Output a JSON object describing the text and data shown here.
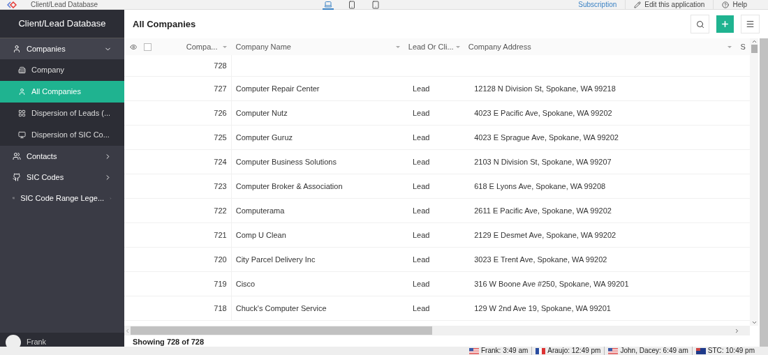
{
  "topbar": {
    "app_title": "Client/Lead Database",
    "devices": [
      {
        "kind": "desktop",
        "selected": true
      },
      {
        "kind": "phone",
        "selected": false
      },
      {
        "kind": "tablet",
        "selected": false
      }
    ],
    "links": [
      {
        "kind": "subscription",
        "label": "Subscription"
      },
      {
        "kind": "edit",
        "label": "Edit this application"
      },
      {
        "kind": "help",
        "label": "Help"
      }
    ]
  },
  "sidebar": {
    "title": "Client/Lead Database",
    "items": [
      {
        "label": "Companies",
        "expanded": true,
        "children": [
          {
            "label": "Company",
            "selected": false
          },
          {
            "label": "All Companies",
            "selected": true
          },
          {
            "label": "Dispersion of Leads (...",
            "selected": false
          },
          {
            "label": "Dispersion of SIC Co...",
            "selected": false
          }
        ]
      },
      {
        "label": "Contacts",
        "expanded": false
      },
      {
        "label": "SIC Codes",
        "expanded": false
      },
      {
        "label": "SIC Code Range Lege...",
        "expanded": false
      }
    ],
    "user": {
      "name": "Frank"
    }
  },
  "main": {
    "title": "All Companies",
    "table": {
      "select_all_checked": false,
      "columns": [
        {
          "label": "Compa..."
        },
        {
          "label": "Company Name"
        },
        {
          "label": "Lead Or Cli..."
        },
        {
          "label": "Company Address"
        },
        {
          "label": "S"
        }
      ],
      "rows": [
        {
          "number": "728"
        },
        {
          "number": "727",
          "name": "Computer Repair Center",
          "type": "Lead",
          "address": "12128 N Division St, Spokane, WA 99218"
        },
        {
          "number": "726",
          "name": "Computer Nutz",
          "type": "Lead",
          "address": "4023 E Pacific Ave, Spokane, WA 99202"
        },
        {
          "number": "725",
          "name": "Computer Guruz",
          "type": "Lead",
          "address": "4023 E Sprague Ave, Spokane, WA 99202"
        },
        {
          "number": "724",
          "name": "Computer Business Solutions",
          "type": "Lead",
          "address": "2103 N Division St, Spokane, WA 99207"
        },
        {
          "number": "723",
          "name": "Computer Broker & Association",
          "type": "Lead",
          "address": "618 E Lyons Ave, Spokane, WA 99208"
        },
        {
          "number": "722",
          "name": "Computerama",
          "type": "Lead",
          "address": "2611 E Pacific Ave, Spokane, WA 99202"
        },
        {
          "number": "721",
          "name": "Comp U Clean",
          "type": "Lead",
          "address": "2129 E Desmet Ave, Spokane, WA 99202"
        },
        {
          "number": "720",
          "name": "City Parcel Delivery Inc",
          "type": "Lead",
          "address": "3023 E Trent Ave, Spokane, WA 99202"
        },
        {
          "number": "719",
          "name": "Cisco",
          "type": "Lead",
          "address": "316 W Boone Ave #250, Spokane, WA 99201"
        },
        {
          "number": "718",
          "name": "Chuck's Computer Service",
          "type": "Lead",
          "address": "129 W 2nd Ave 19, Spokane, WA 99201"
        }
      ]
    },
    "footer": "Showing 728 of 728"
  },
  "taskbar": {
    "clocks": [
      {
        "label": "Frank: 3:49 am"
      },
      {
        "label": "Araujo: 12:49 pm"
      },
      {
        "label": "John, Dacey: 6:49 am"
      },
      {
        "label": "STC: 10:49 pm"
      }
    ]
  }
}
